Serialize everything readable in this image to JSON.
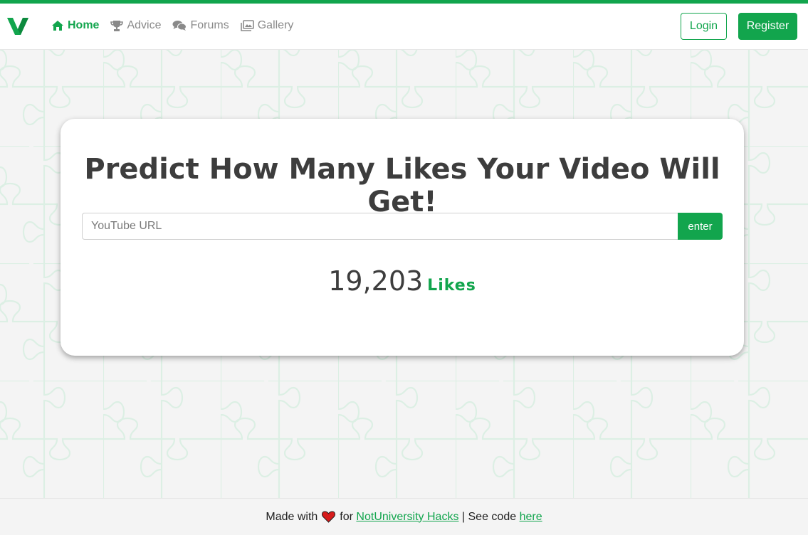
{
  "nav": {
    "logo": "V",
    "links": [
      {
        "label": "Home",
        "icon": "home-icon",
        "active": true
      },
      {
        "label": "Advice",
        "icon": "trophy-icon",
        "active": false
      },
      {
        "label": "Forums",
        "icon": "comments-icon",
        "active": false
      },
      {
        "label": "Gallery",
        "icon": "images-icon",
        "active": false
      }
    ],
    "login_label": "Login",
    "register_label": "Register"
  },
  "card": {
    "title": "Predict How Many Likes Your Video Will Get!",
    "input_placeholder": "YouTube URL",
    "input_value": "",
    "enter_label": "enter",
    "result_count": "19,203",
    "result_unit": "Likes"
  },
  "footer": {
    "made_with": "Made with",
    "heart_icon": "heart-icon",
    "for_text": "for",
    "org_link": "NotUniversity Hacks",
    "separator": "| See code",
    "code_link": "here"
  },
  "colors": {
    "accent": "#12a54d",
    "heart": "#d61a1a",
    "text": "#3d3d3d"
  }
}
